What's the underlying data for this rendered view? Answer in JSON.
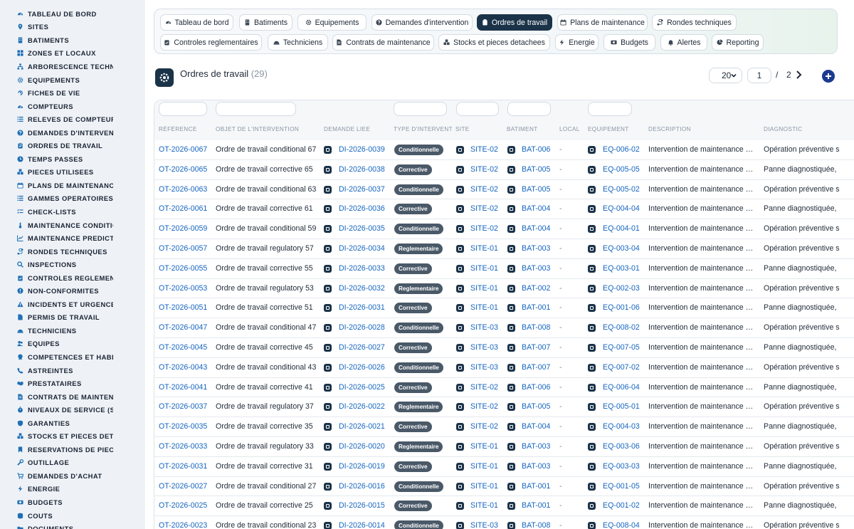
{
  "sidebar": {
    "items": [
      {
        "label": "TABLEAU DE BORD",
        "icon": "dashboard-icon"
      },
      {
        "label": "SITES",
        "icon": "map-pin-icon"
      },
      {
        "label": "BATIMENTS",
        "icon": "building-icon"
      },
      {
        "label": "ZONES ET LOCAUX",
        "icon": "grid-icon"
      },
      {
        "label": "ARBORESCENCE TECHNIQUE",
        "icon": "sitemap-icon"
      },
      {
        "label": "EQUIPEMENTS",
        "icon": "cogs-icon"
      },
      {
        "label": "FICHES DE VIE",
        "icon": "history-icon"
      },
      {
        "label": "COMPTEURS",
        "icon": "gauge-icon"
      },
      {
        "label": "RELEVES DE COMPTEURS",
        "icon": "list-icon"
      },
      {
        "label": "DEMANDES D'INTERVENTION",
        "icon": "question-icon"
      },
      {
        "label": "ORDRES DE TRAVAIL",
        "icon": "clipboard-icon"
      },
      {
        "label": "TEMPS PASSES",
        "icon": "clock-icon"
      },
      {
        "label": "PIECES UTILISEES",
        "icon": "boxes-icon"
      },
      {
        "label": "PLANS DE MAINTENANCE",
        "icon": "calendar-icon"
      },
      {
        "label": "GAMMES OPERATOIRES",
        "icon": "list-icon"
      },
      {
        "label": "CHECK-LISTS",
        "icon": "checklist-icon"
      },
      {
        "label": "MAINTENANCE CONDITIONNELLE",
        "icon": "thermometer-icon"
      },
      {
        "label": "MAINTENANCE PREDICTIVE",
        "icon": "chart-line-icon"
      },
      {
        "label": "RONDES TECHNIQUES",
        "icon": "route-icon"
      },
      {
        "label": "INSPECTIONS",
        "icon": "search-icon"
      },
      {
        "label": "CONTROLES REGLEMENTAIRES",
        "icon": "clipboard-check-icon"
      },
      {
        "label": "NON-CONFORMITES",
        "icon": "alert-circle-icon"
      },
      {
        "label": "INCIDENTS ET URGENCES",
        "icon": "warning-icon"
      },
      {
        "label": "PERMIS DE TRAVAIL",
        "icon": "file-icon"
      },
      {
        "label": "TECHNICIENS",
        "icon": "hard-hat-icon"
      },
      {
        "label": "EQUIPES",
        "icon": "users-icon"
      },
      {
        "label": "COMPETENCES ET HABILITATIONS",
        "icon": "certificate-icon"
      },
      {
        "label": "ASTREINTES",
        "icon": "phone-icon"
      },
      {
        "label": "PRESTATAIRES",
        "icon": "handshake-icon"
      },
      {
        "label": "CONTRATS DE MAINTENANCE",
        "icon": "file-contract-icon"
      },
      {
        "label": "NIVEAUX DE SERVICE (SLA)",
        "icon": "stopwatch-icon"
      },
      {
        "label": "GARANTIES",
        "icon": "shield-icon"
      },
      {
        "label": "STOCKS ET PIECES DETACHEES",
        "icon": "boxes-icon"
      },
      {
        "label": "RESERVATIONS DE PIECES",
        "icon": "bookmark-icon"
      },
      {
        "label": "OUTILLAGE",
        "icon": "tools-icon"
      },
      {
        "label": "DEMANDES D'ACHAT",
        "icon": "cart-icon"
      },
      {
        "label": "ENERGIE",
        "icon": "bolt-icon"
      },
      {
        "label": "BUDGETS",
        "icon": "money-icon"
      },
      {
        "label": "COUTS",
        "icon": "coins-icon"
      },
      {
        "label": "DOCUMENTS",
        "icon": "folder-icon"
      }
    ]
  },
  "tabs": [
    {
      "label": "Tableau de bord",
      "icon": "dashboard-icon",
      "active": false
    },
    {
      "label": "Batiments",
      "icon": "building-icon",
      "active": false
    },
    {
      "label": "Equipements",
      "icon": "cogs-icon",
      "active": false
    },
    {
      "label": "Demandes d'intervention",
      "icon": "question-icon",
      "active": false
    },
    {
      "label": "Ordres de travail",
      "icon": "clipboard-icon",
      "active": true
    },
    {
      "label": "Plans de maintenance",
      "icon": "calendar-icon",
      "active": false
    },
    {
      "label": "Rondes techniques",
      "icon": "route-icon",
      "active": false
    },
    {
      "label": "Controles reglementaires",
      "icon": "clipboard-check-icon",
      "active": false
    },
    {
      "label": "Techniciens",
      "icon": "hard-hat-icon",
      "active": false
    },
    {
      "label": "Contrats de maintenance",
      "icon": "file-contract-icon",
      "active": false
    },
    {
      "label": "Stocks et pieces detachees",
      "icon": "boxes-icon",
      "active": false
    },
    {
      "label": "Energie",
      "icon": "bolt-icon",
      "active": false
    },
    {
      "label": "Budgets",
      "icon": "money-icon",
      "active": false
    },
    {
      "label": "Alertes",
      "icon": "bell-icon",
      "active": false
    },
    {
      "label": "Reporting",
      "icon": "chart-pie-icon",
      "active": false
    }
  ],
  "page": {
    "title": "Ordres de travail",
    "count": "(29)",
    "icon": "cogs-icon"
  },
  "pagination": {
    "page_size": "20",
    "current_page": "1",
    "separator": "/",
    "total_pages": "2",
    "next_icon": "chevron-right-icon",
    "add_icon": "plus-icon"
  },
  "table": {
    "columns": [
      "RÉFÉRENCE",
      "OBJET DE L'INTERVENTION",
      "DEMANDE LIEE",
      "TYPE D'INTERVENTION",
      "SITE",
      "BATIMENT",
      "LOCAL",
      "EQUIPEMENT",
      "DESCRIPTION",
      "DIAGNOSTIC"
    ],
    "link_icon": "external-link-icon",
    "rows": [
      {
        "ref": "OT-2026-0067",
        "objet": "Ordre de travail conditional 67",
        "demande": "DI-2026-0039",
        "type": "Conditionnelle",
        "site": "SITE-02",
        "batiment": "BAT-006",
        "local": "-",
        "equipement": "EQ-006-02",
        "description": "Intervention de maintenance …",
        "diagnostic": "Opération préventive s"
      },
      {
        "ref": "OT-2026-0065",
        "objet": "Ordre de travail corrective 65",
        "demande": "DI-2026-0038",
        "type": "Corrective",
        "site": "SITE-02",
        "batiment": "BAT-005",
        "local": "-",
        "equipement": "EQ-005-05",
        "description": "Intervention de maintenance …",
        "diagnostic": "Panne diagnostiquée,"
      },
      {
        "ref": "OT-2026-0063",
        "objet": "Ordre de travail conditional 63",
        "demande": "DI-2026-0037",
        "type": "Conditionnelle",
        "site": "SITE-02",
        "batiment": "BAT-005",
        "local": "-",
        "equipement": "EQ-005-02",
        "description": "Intervention de maintenance …",
        "diagnostic": "Opération préventive s"
      },
      {
        "ref": "OT-2026-0061",
        "objet": "Ordre de travail corrective 61",
        "demande": "DI-2026-0036",
        "type": "Corrective",
        "site": "SITE-02",
        "batiment": "BAT-004",
        "local": "-",
        "equipement": "EQ-004-04",
        "description": "Intervention de maintenance …",
        "diagnostic": "Panne diagnostiquée,"
      },
      {
        "ref": "OT-2026-0059",
        "objet": "Ordre de travail conditional 59",
        "demande": "DI-2026-0035",
        "type": "Conditionnelle",
        "site": "SITE-02",
        "batiment": "BAT-004",
        "local": "-",
        "equipement": "EQ-004-01",
        "description": "Intervention de maintenance …",
        "diagnostic": "Opération préventive s"
      },
      {
        "ref": "OT-2026-0057",
        "objet": "Ordre de travail regulatory 57",
        "demande": "DI-2026-0034",
        "type": "Reglementaire",
        "site": "SITE-01",
        "batiment": "BAT-003",
        "local": "-",
        "equipement": "EQ-003-04",
        "description": "Intervention de maintenance …",
        "diagnostic": "Opération préventive s"
      },
      {
        "ref": "OT-2026-0055",
        "objet": "Ordre de travail corrective 55",
        "demande": "DI-2026-0033",
        "type": "Corrective",
        "site": "SITE-01",
        "batiment": "BAT-003",
        "local": "-",
        "equipement": "EQ-003-01",
        "description": "Intervention de maintenance …",
        "diagnostic": "Panne diagnostiquée,"
      },
      {
        "ref": "OT-2026-0053",
        "objet": "Ordre de travail regulatory 53",
        "demande": "DI-2026-0032",
        "type": "Reglementaire",
        "site": "SITE-01",
        "batiment": "BAT-002",
        "local": "-",
        "equipement": "EQ-002-03",
        "description": "Intervention de maintenance …",
        "diagnostic": "Opération préventive s"
      },
      {
        "ref": "OT-2026-0051",
        "objet": "Ordre de travail corrective 51",
        "demande": "DI-2026-0031",
        "type": "Corrective",
        "site": "SITE-01",
        "batiment": "BAT-001",
        "local": "-",
        "equipement": "EQ-001-06",
        "description": "Intervention de maintenance …",
        "diagnostic": "Panne diagnostiquée,"
      },
      {
        "ref": "OT-2026-0047",
        "objet": "Ordre de travail conditional 47",
        "demande": "DI-2026-0028",
        "type": "Conditionnelle",
        "site": "SITE-03",
        "batiment": "BAT-008",
        "local": "-",
        "equipement": "EQ-008-02",
        "description": "Intervention de maintenance …",
        "diagnostic": "Opération préventive s"
      },
      {
        "ref": "OT-2026-0045",
        "objet": "Ordre de travail corrective 45",
        "demande": "DI-2026-0027",
        "type": "Corrective",
        "site": "SITE-03",
        "batiment": "BAT-007",
        "local": "-",
        "equipement": "EQ-007-05",
        "description": "Intervention de maintenance …",
        "diagnostic": "Panne diagnostiquée,"
      },
      {
        "ref": "OT-2026-0043",
        "objet": "Ordre de travail conditional 43",
        "demande": "DI-2026-0026",
        "type": "Conditionnelle",
        "site": "SITE-03",
        "batiment": "BAT-007",
        "local": "-",
        "equipement": "EQ-007-02",
        "description": "Intervention de maintenance …",
        "diagnostic": "Opération préventive s"
      },
      {
        "ref": "OT-2026-0041",
        "objet": "Ordre de travail corrective 41",
        "demande": "DI-2026-0025",
        "type": "Corrective",
        "site": "SITE-02",
        "batiment": "BAT-006",
        "local": "-",
        "equipement": "EQ-006-04",
        "description": "Intervention de maintenance …",
        "diagnostic": "Panne diagnostiquée,"
      },
      {
        "ref": "OT-2026-0037",
        "objet": "Ordre de travail regulatory 37",
        "demande": "DI-2026-0022",
        "type": "Reglementaire",
        "site": "SITE-02",
        "batiment": "BAT-005",
        "local": "-",
        "equipement": "EQ-005-01",
        "description": "Intervention de maintenance …",
        "diagnostic": "Opération préventive s"
      },
      {
        "ref": "OT-2026-0035",
        "objet": "Ordre de travail corrective 35",
        "demande": "DI-2026-0021",
        "type": "Corrective",
        "site": "SITE-02",
        "batiment": "BAT-004",
        "local": "-",
        "equipement": "EQ-004-03",
        "description": "Intervention de maintenance …",
        "diagnostic": "Panne diagnostiquée,"
      },
      {
        "ref": "OT-2026-0033",
        "objet": "Ordre de travail regulatory 33",
        "demande": "DI-2026-0020",
        "type": "Reglementaire",
        "site": "SITE-01",
        "batiment": "BAT-003",
        "local": "-",
        "equipement": "EQ-003-06",
        "description": "Intervention de maintenance …",
        "diagnostic": "Opération préventive s"
      },
      {
        "ref": "OT-2026-0031",
        "objet": "Ordre de travail corrective 31",
        "demande": "DI-2026-0019",
        "type": "Corrective",
        "site": "SITE-01",
        "batiment": "BAT-003",
        "local": "-",
        "equipement": "EQ-003-03",
        "description": "Intervention de maintenance …",
        "diagnostic": "Panne diagnostiquée,"
      },
      {
        "ref": "OT-2026-0027",
        "objet": "Ordre de travail conditional 27",
        "demande": "DI-2026-0016",
        "type": "Conditionnelle",
        "site": "SITE-01",
        "batiment": "BAT-001",
        "local": "-",
        "equipement": "EQ-001-05",
        "description": "Intervention de maintenance …",
        "diagnostic": "Opération préventive s"
      },
      {
        "ref": "OT-2026-0025",
        "objet": "Ordre de travail corrective 25",
        "demande": "DI-2026-0015",
        "type": "Corrective",
        "site": "SITE-01",
        "batiment": "BAT-001",
        "local": "-",
        "equipement": "EQ-001-02",
        "description": "Intervention de maintenance …",
        "diagnostic": "Panne diagnostiquée,"
      },
      {
        "ref": "OT-2026-0023",
        "objet": "Ordre de travail conditional 23",
        "demande": "DI-2026-0014",
        "type": "Conditionnelle",
        "site": "SITE-03",
        "batiment": "BAT-008",
        "local": "-",
        "equipement": "EQ-008-04",
        "description": "Intervention de maintenance …",
        "diagnostic": "Opération préventive s"
      }
    ]
  },
  "colors": {
    "accent": "#1b3349",
    "link": "#1565c0",
    "badge": "#4a5968",
    "sidebar_bg": "#eef2f6",
    "add_button": "#1b3b8f"
  }
}
